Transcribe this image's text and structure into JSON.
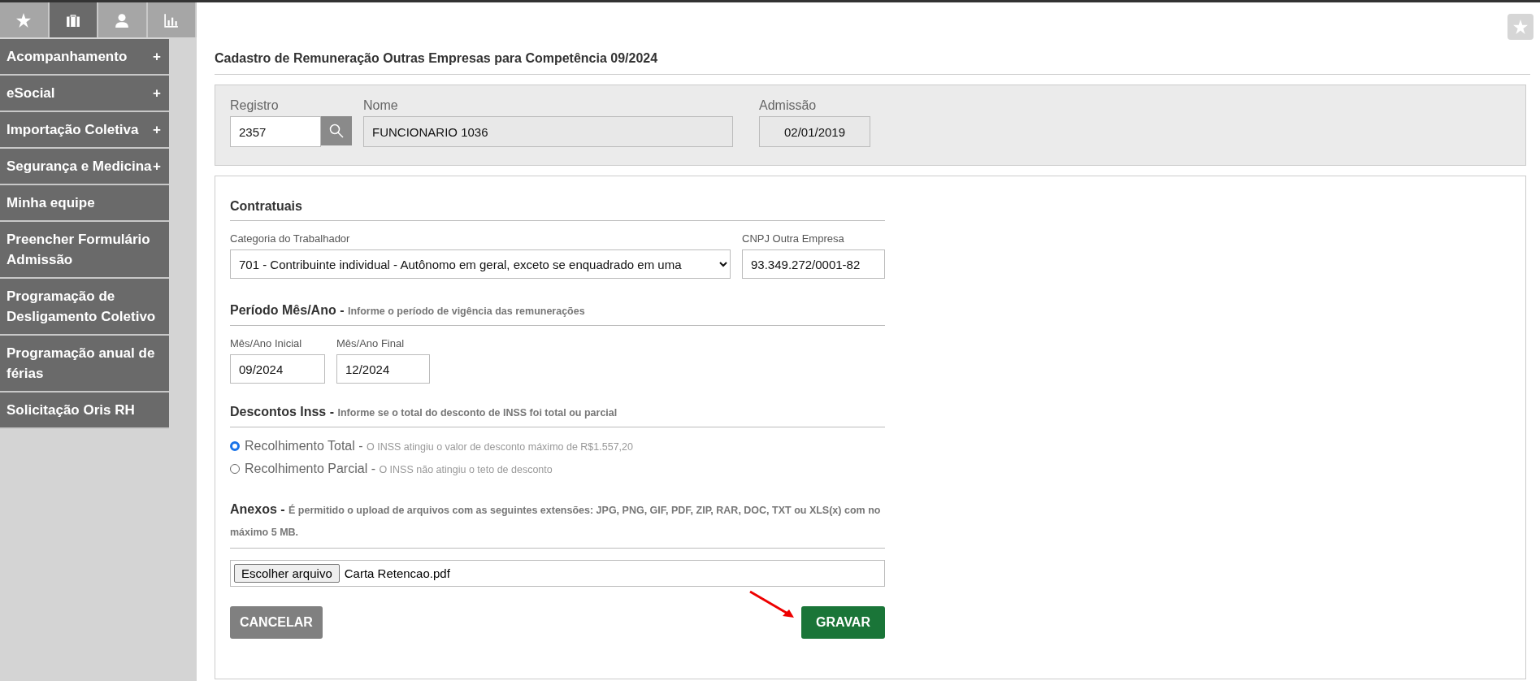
{
  "sidebar": {
    "tabs": [
      {
        "kind": "star",
        "selected": false
      },
      {
        "kind": "briefcase",
        "selected": true
      },
      {
        "kind": "person",
        "selected": false
      },
      {
        "kind": "chart",
        "selected": false
      }
    ],
    "items": [
      {
        "label": "Acompanhamento",
        "expander": "+"
      },
      {
        "label": "eSocial",
        "expander": "+"
      },
      {
        "label": "Importação Coletiva",
        "expander": "+"
      },
      {
        "label": "Segurança e Medicina",
        "expander": "+"
      },
      {
        "label": "Minha equipe"
      },
      {
        "label": "Preencher Formulário Admissão"
      },
      {
        "label": "Programação de Desligamento Coletivo"
      },
      {
        "label": "Programação anual de férias"
      },
      {
        "label": "Solicitação Oris RH"
      }
    ]
  },
  "page_title": "Cadastro de Remuneração Outras Empresas para Competência 09/2024",
  "employee": {
    "registro_label": "Registro",
    "registro": "2357",
    "nome_label": "Nome",
    "nome": "FUNCIONARIO 1036",
    "admissao_label": "Admissão",
    "admissao": "02/01/2019"
  },
  "contratuais": {
    "title": "Contratuais",
    "categoria_label": "Categoria do Trabalhador",
    "categoria": "701 - Contribuinte individual - Autônomo em geral, exceto se enquadrado em uma",
    "cnpj_label": "CNPJ Outra Empresa",
    "cnpj": "93.349.272/0001-82"
  },
  "periodo": {
    "title": "Período Mês/Ano -",
    "hint": "Informe o período de vigência das remunerações",
    "inicial_label": "Mês/Ano Inicial",
    "inicial": "09/2024",
    "final_label": "Mês/Ano Final",
    "final": "12/2024"
  },
  "descontos": {
    "title": "Descontos Inss -",
    "hint": "Informe se o total do desconto de INSS foi total ou parcial",
    "options": [
      {
        "label": "Recolhimento Total -",
        "note": "O INSS atingiu o valor de desconto máximo de R$1.557,20",
        "selected": true
      },
      {
        "label": "Recolhimento Parcial -",
        "note": "O INSS não atingiu o teto de desconto",
        "selected": false
      }
    ]
  },
  "anexos": {
    "title": "Anexos -",
    "hint": "É permitido o upload de arquivos com as seguintes extensões: JPG, PNG, GIF, PDF, ZIP, RAR, DOC, TXT ou XLS(x) com no máximo 5 MB.",
    "button": "Escolher arquivo",
    "file": "Carta Retencao.pdf"
  },
  "buttons": {
    "cancel": "CANCELAR",
    "save": "GRAVAR"
  }
}
